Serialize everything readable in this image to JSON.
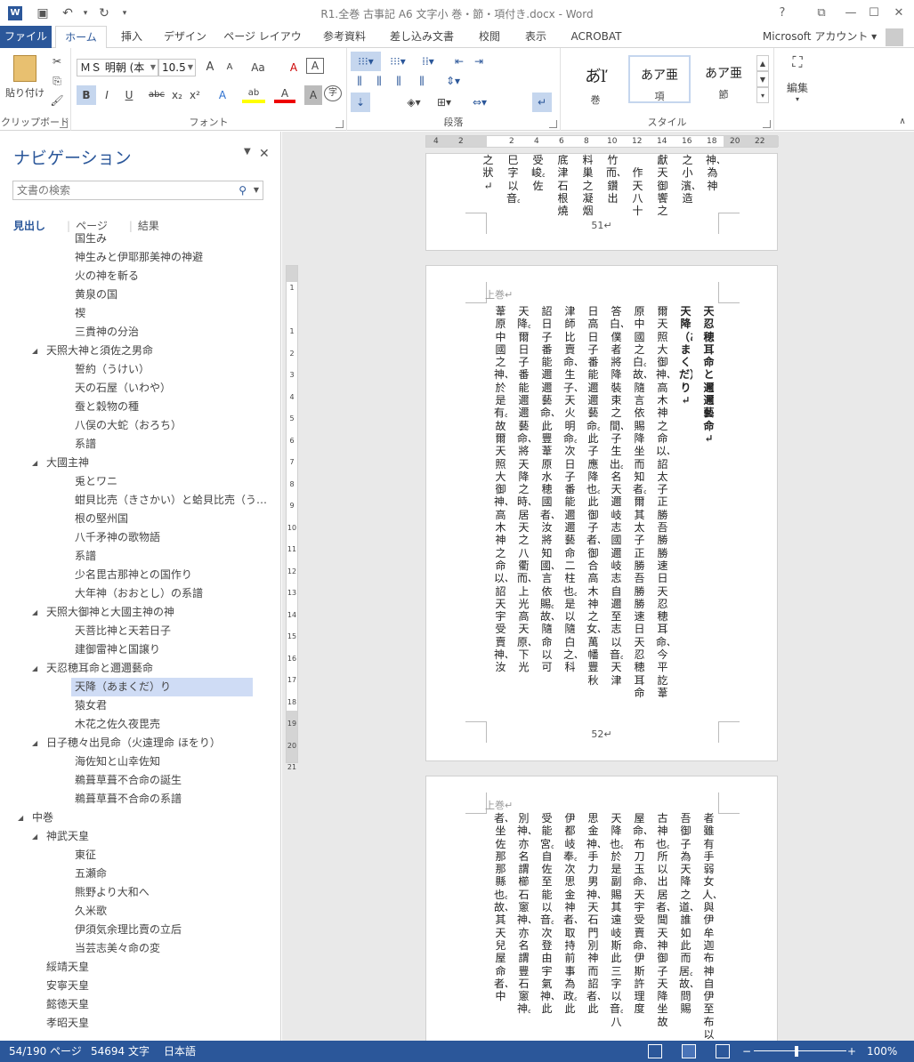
{
  "window": {
    "title": "R1.全巻 古事記 A6 文字小 巻・節・項付き.docx - Word",
    "app_icon": "word-icon",
    "quick_access": [
      "save-icon",
      "undo-icon",
      "redo-icon",
      "customize-icon"
    ],
    "controls": [
      "help-icon",
      "ribbon-display-icon",
      "minimize-icon",
      "maximize-icon",
      "close-icon"
    ]
  },
  "tabs": {
    "items": [
      "ファイル",
      "ホーム",
      "挿入",
      "デザイン",
      "ページ レイアウト",
      "参考資料",
      "差し込み文書",
      "校閲",
      "表示",
      "ACROBAT"
    ],
    "active": "ホーム",
    "account": "Microsoft アカウント"
  },
  "ribbon": {
    "clipboard": {
      "label": "クリップボード",
      "paste": "貼り付け"
    },
    "font": {
      "label": "フォント",
      "font_name": "ＭＳ 明朝 (本",
      "font_size": "10.5",
      "buttons": [
        "A",
        "A",
        "Aa",
        "A",
        "A",
        "B",
        "I",
        "U",
        "abc",
        "x₂",
        "x²",
        "A",
        "ab",
        "A",
        "A",
        "字"
      ]
    },
    "paragraph": {
      "label": "段落"
    },
    "styles": {
      "label": "スタイル",
      "items": [
        {
          "sample": "あ゙ľ",
          "name": "巻"
        },
        {
          "sample": "あア亜",
          "name": "項"
        },
        {
          "sample": "あア亜",
          "name": "節"
        }
      ]
    },
    "editing": {
      "label": "編集"
    }
  },
  "nav": {
    "title": "ナビゲーション",
    "search_placeholder": "文書の検索",
    "tabs": [
      "見出し",
      "ページ",
      "結果"
    ],
    "active_tab": "見出し",
    "tree": [
      {
        "label": "国生み",
        "level": 3
      },
      {
        "label": "神生みと伊耶那美神の神避",
        "level": 3
      },
      {
        "label": "火の神を斬る",
        "level": 3
      },
      {
        "label": "黄泉の国",
        "level": 3
      },
      {
        "label": "禊",
        "level": 3
      },
      {
        "label": "三貴神の分治",
        "level": 3
      },
      {
        "label": "天照大神と須佐之男命",
        "level": 2,
        "expanded": true
      },
      {
        "label": "誓約（うけい）",
        "level": 3
      },
      {
        "label": "天の石屋（いわや）",
        "level": 3
      },
      {
        "label": "蚕と穀物の種",
        "level": 3
      },
      {
        "label": "八俣の大蛇（おろち）",
        "level": 3
      },
      {
        "label": "系譜",
        "level": 3
      },
      {
        "label": "大國主神",
        "level": 2,
        "expanded": true
      },
      {
        "label": "兎とワニ",
        "level": 3
      },
      {
        "label": "蚶貝比売（きさかい）と蛤貝比売（う…",
        "level": 3
      },
      {
        "label": "根の堅州国",
        "level": 3
      },
      {
        "label": "八千矛神の歌物語",
        "level": 3
      },
      {
        "label": "系譜",
        "level": 3
      },
      {
        "label": "少名毘古那神との国作り",
        "level": 3
      },
      {
        "label": "大年神（おおとし）の系譜",
        "level": 3
      },
      {
        "label": "天照大御神と大國主神の神",
        "level": 2,
        "expanded": true
      },
      {
        "label": "天菩比神と天若日子",
        "level": 3
      },
      {
        "label": "建御雷神と国譲り",
        "level": 3
      },
      {
        "label": "天忍穂耳命と邇邇藝命",
        "level": 2,
        "expanded": true
      },
      {
        "label": "天降（あまくだ）り",
        "level": 3,
        "selected": true
      },
      {
        "label": "猿女君",
        "level": 3
      },
      {
        "label": "木花之佐久夜毘売",
        "level": 3
      },
      {
        "label": "日子穂々出見命（火遠理命 ほをり）",
        "level": 2,
        "expanded": true
      },
      {
        "label": "海佐知と山幸佐知",
        "level": 3
      },
      {
        "label": "鵜葺草葺不合命の誕生",
        "level": 3
      },
      {
        "label": "鵜葺草葺不合命の系譜",
        "level": 3
      },
      {
        "label": "中巻",
        "level": 1,
        "expanded": true
      },
      {
        "label": "神武天皇",
        "level": 2,
        "expanded": true
      },
      {
        "label": "東征",
        "level": 3
      },
      {
        "label": "五瀬命",
        "level": 3
      },
      {
        "label": "熊野より大和へ",
        "level": 3
      },
      {
        "label": "久米歌",
        "level": 3
      },
      {
        "label": "伊須気余理比賣の立后",
        "level": 3
      },
      {
        "label": "当芸志美々命の変",
        "level": 3
      },
      {
        "label": "綏靖天皇",
        "level": 2
      },
      {
        "label": "安寧天皇",
        "level": 2
      },
      {
        "label": "懿徳天皇",
        "level": 2
      },
      {
        "label": "孝昭天皇",
        "level": 2
      }
    ]
  },
  "ruler": {
    "h_labels": [
      "4",
      "2",
      "",
      "2",
      "4",
      "6",
      "8",
      "10",
      "12",
      "14",
      "16",
      "18",
      "20",
      "22"
    ],
    "v_labels": [
      "1",
      "",
      "1",
      "2",
      "3",
      "4",
      "5",
      "6",
      "7",
      "8",
      "9",
      "10",
      "11",
      "12",
      "13",
      "14",
      "15",
      "16",
      "17",
      "18",
      "19",
      "20",
      "21"
    ]
  },
  "pages": [
    {
      "page_number": "51↵",
      "columns": [
        {
          "text": "神、為神",
          "bold": false
        },
        {
          "text": "之小濱、造",
          "bold": false
        },
        {
          "text": "獻天御饗之",
          "bold": false
        },
        {
          "text": "　作天八十",
          "bold": false
        },
        {
          "text": "竹而、鑽出",
          "bold": false
        },
        {
          "text": "料巢之凝烟",
          "bold": false
        },
        {
          "text": "底津石根燒",
          "bold": false
        },
        {
          "text": "受峻。佐",
          "bold": false
        },
        {
          "text": "巳字以音。",
          "bold": false
        },
        {
          "text": "之狀↵",
          "bold": false
        }
      ]
    },
    {
      "header": "上巻↵",
      "page_number": "52↵",
      "columns": [
        {
          "text": "天忍穂耳命と邇邇藝命↵",
          "bold": true
        },
        {
          "text": "天降（あまくだ）り↵",
          "bold": true
        },
        {
          "text": "爾天照大御神、高木神之命以、詔太子正勝吾勝勝速日天忍穂耳命、今平訖葦",
          "bold": false
        },
        {
          "text": "原中國之白。故、隨言依賜降坐而知者。爾其太子正勝吾勝勝速日天忍穂耳命",
          "bold": false
        },
        {
          "text": "答白、僕者將降裝束之間、子生出。名天邇岐志國邇岐志自邇至志以音。天津",
          "bold": false
        },
        {
          "text": "日高日子番能邇邇藝命。此子應降也。此御子者、御合高木神之女、萬幡豐秋",
          "bold": false
        },
        {
          "text": "津師比賣命、生子、天火明命。次日子番能邇邇藝命二柱也。是以隨白之、科",
          "bold": false
        },
        {
          "text": "詔日子番能邇邇藝命、此豐葦原水穂國者、汝將知國、言依賜。故、隨命以可",
          "bold": false
        },
        {
          "text": "天降。爾日子番能邇邇藝命、將天降之時、居天之八衢而、上光高天原、下光",
          "bold": false
        },
        {
          "text": "葦原中國之神、於是有。故爾天照大御神、高木神之命以、詔天宇受賣神、汝",
          "bold": false
        }
      ]
    },
    {
      "header": "上巻↵",
      "columns": [
        {
          "text": "者雖有手弱女人、與伊牟迦布神自伊至布以",
          "bold": false
        },
        {
          "text": "吾御子為天降之道、誰如此而居。故、問賜",
          "bold": false
        },
        {
          "text": "古神也。所以出居者、聞天神御子天降坐故",
          "bold": false
        },
        {
          "text": "屋命、布刀玉命、天宇受賣命、伊斯許理度",
          "bold": false
        },
        {
          "text": "天降也。於是副賜其遠岐斯此三字以音。八",
          "bold": false
        },
        {
          "text": "思金神、手力男神、天石門別神而詔者、此",
          "bold": false
        },
        {
          "text": "伊都岐奉。次思金神者、取持前事為政。此",
          "bold": false
        },
        {
          "text": "受能宮。自佐至能以音。次登由宇氣神、此",
          "bold": false
        },
        {
          "text": "別神、亦名謂櫛石窻神、亦名謂豐石窻神。",
          "bold": false
        },
        {
          "text": "者、坐佐那那縣也。故、其天兒屋命者、中",
          "bold": false
        }
      ]
    }
  ],
  "status": {
    "page": "54/190 ページ",
    "words": "54694 文字",
    "language": "日本語",
    "zoom": "100%",
    "zoom_level": 1.0
  }
}
